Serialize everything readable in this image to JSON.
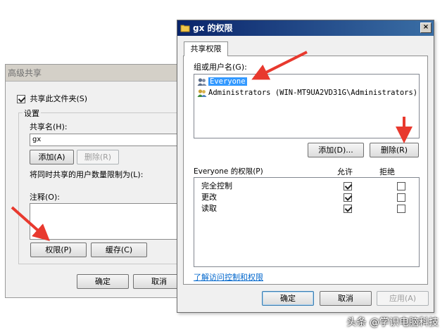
{
  "back_dialog": {
    "title": "高级共享",
    "share_checkbox_label": "共享此文件夹(S)",
    "settings_group_label": "设置",
    "share_name_label": "共享名(H):",
    "share_name_value": "gx",
    "add_button": "添加(A)",
    "remove_button": "删除(R)",
    "limit_label": "将同时共享的用户数量限制为(L):",
    "comment_label": "注释(O):",
    "permissions_button": "权限(P)",
    "caching_button": "缓存(C)",
    "ok_button": "确定",
    "cancel_button": "取消"
  },
  "front_dialog": {
    "title": "gx 的权限",
    "close_glyph": "×",
    "tab_label": "共享权限",
    "group_label": "组或用户名(G):",
    "users": [
      {
        "name": "Everyone"
      },
      {
        "name": "Administrators (WIN-MT9UA2VD31G\\Administrators)"
      }
    ],
    "add_button": "添加(D)...",
    "remove_button": "删除(R)",
    "perm_header": "Everyone 的权限(P)",
    "allow_header": "允许",
    "deny_header": "拒绝",
    "permissions": [
      {
        "name": "完全控制",
        "allow": true,
        "deny": false
      },
      {
        "name": "更改",
        "allow": true,
        "deny": false
      },
      {
        "name": "读取",
        "allow": true,
        "deny": false
      }
    ],
    "learn_link": "了解访问控制和权限",
    "ok_button": "确定",
    "cancel_button": "取消",
    "apply_button": "应用(A)"
  },
  "watermark": "头条 @学识电脑科技",
  "colors": {
    "title_bar_start": "#0a246a",
    "title_bar_end": "#3a6ea5",
    "selection": "#3399ff",
    "arrow": "#e8392e",
    "link": "#0066cc"
  },
  "icons": {
    "folder": "folder-icon",
    "close": "close-icon",
    "users": "users-icon",
    "checkbox": "checkbox-icon",
    "arrow": "red-arrow-annotation"
  }
}
